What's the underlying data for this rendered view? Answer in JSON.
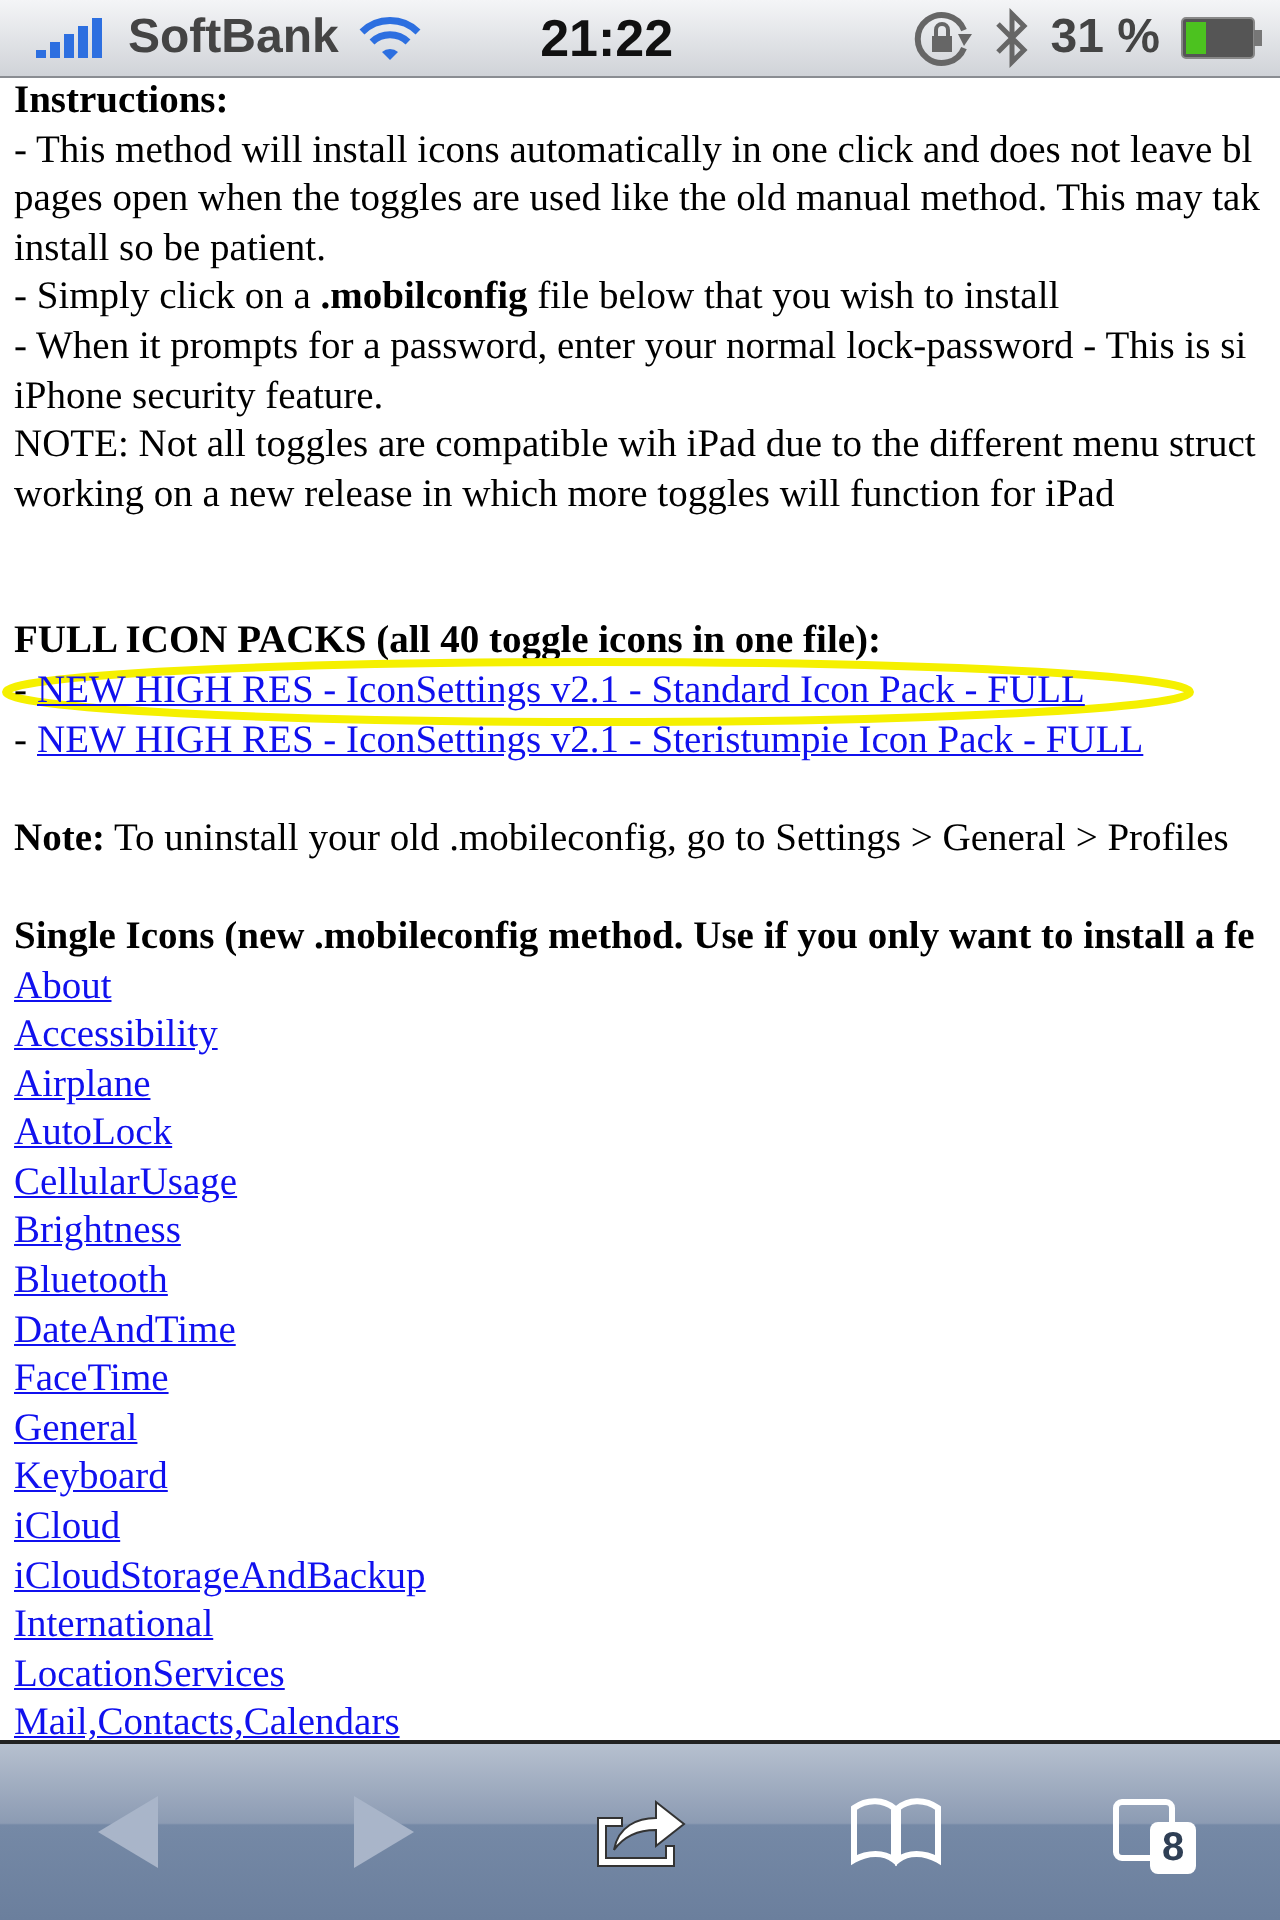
{
  "status_bar": {
    "carrier": "SoftBank",
    "time": "21:22",
    "battery_percent": "31 %"
  },
  "instructions": {
    "heading": "Instructions:",
    "lines": [
      "- This method will install icons automatically in one click and does not leave bl",
      "pages open when the toggles are used like the old manual method. This may tak",
      "install so be patient.",
      "- Simply click on a **.mobilconfig** file below that you wish to install",
      "- When it prompts for a password, enter your normal lock-password - This is si",
      "iPhone security feature.",
      "NOTE: Not all toggles are compatible wih iPad due to the different menu struct",
      "working on a new release in which more toggles will function for iPad"
    ]
  },
  "full_packs": {
    "heading": "FULL ICON PACKS (all 40 toggle icons in one file):",
    "links": [
      {
        "prefix": "-",
        "text": "NEW HIGH RES - IconSettings v2.1 - Standard Icon Pack - FULL",
        "highlighted": true
      },
      {
        "prefix": "-",
        "text": "NEW HIGH RES - IconSettings v2.1 - Steristumpie Icon Pack - FULL",
        "highlighted": false
      }
    ]
  },
  "note": "**Note:** To uninstall your old .mobileconfig, go to Settings > General > Profiles",
  "single_icons": {
    "heading": "Single Icons (new .mobileconfig method. Use if you only want to install a fe",
    "links": [
      "About",
      "Accessibility",
      "Airplane",
      "AutoLock",
      "CellularUsage",
      "Brightness",
      "Bluetooth",
      "DateAndTime",
      "FaceTime",
      "General",
      "Keyboard",
      "iCloud",
      "iCloudStorageAndBackup",
      "International",
      "LocationServices",
      "Mail,Contacts,Calendars"
    ]
  },
  "toolbar": {
    "buttons": [
      {
        "kind": "back",
        "disabled": true
      },
      {
        "kind": "forward",
        "disabled": true
      },
      {
        "kind": "share",
        "disabled": false
      },
      {
        "kind": "bookmarks",
        "disabled": false
      },
      {
        "kind": "tabs",
        "disabled": false,
        "badge": "8"
      }
    ]
  }
}
